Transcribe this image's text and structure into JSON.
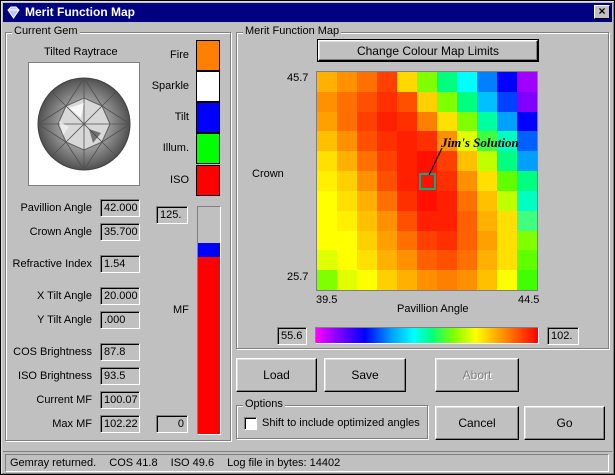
{
  "window": {
    "title": "Merit Function Map",
    "close_glyph": "×"
  },
  "current_gem": {
    "group_title": "Current Gem",
    "image_caption": "Tilted Raytrace",
    "legend": [
      {
        "label": "Fire",
        "color": "#ff8000"
      },
      {
        "label": "Sparkle",
        "color": "#ffffff"
      },
      {
        "label": "Tilt",
        "color": "#0000ff"
      },
      {
        "label": "Illum.",
        "color": "#00ff00"
      },
      {
        "label": "ISO",
        "color": "#ff0000"
      }
    ],
    "fields": [
      {
        "label": "Pavillion Angle",
        "value": "42.000"
      },
      {
        "label": "Crown Angle",
        "value": "35.700"
      },
      {
        "label": "Refractive Index",
        "value": "1.54"
      },
      {
        "label": "X Tilt Angle",
        "value": "20.000"
      },
      {
        "label": "Y Tilt Angle",
        "value": ".000"
      },
      {
        "label": "COS Brightness",
        "value": "87.8"
      },
      {
        "label": "ISO Brightness",
        "value": "93.5"
      },
      {
        "label": "Current MF",
        "value": "100.07"
      },
      {
        "label": "Max MF",
        "value": "102.22"
      }
    ],
    "mf_bar": {
      "label": "MF",
      "max_value": "125.",
      "min_value": "0",
      "blue_fraction": 0.06,
      "red_fraction": 0.78
    }
  },
  "merit_map": {
    "group_title": "Merit Function Map",
    "button_label": "Change Colour Map Limits",
    "y_label": "Crown",
    "y_max": "45.7",
    "y_min": "25.7",
    "x_label": "Pavillion Angle",
    "x_min": "39.5",
    "x_max": "44.5",
    "annotation": "Jim's Solution",
    "colorbar_min": "55.6",
    "colorbar_max": "102.",
    "grid_colors": [
      [
        "#ffb000",
        "#ff9000",
        "#ff7000",
        "#ff4000",
        "#ffd800",
        "#80ff00",
        "#00ff80",
        "#00ffff",
        "#0080ff",
        "#0000ff",
        "#a000ff"
      ],
      [
        "#ff9000",
        "#ff7000",
        "#ff5000",
        "#ff3000",
        "#ff5000",
        "#ffd000",
        "#80ff00",
        "#00ff80",
        "#00c0ff",
        "#0040ff",
        "#8000ff"
      ],
      [
        "#ffa000",
        "#ff7000",
        "#ff4000",
        "#ff2000",
        "#ff3000",
        "#ff8000",
        "#ffe000",
        "#80ff00",
        "#00ffa0",
        "#00a0ff",
        "#0000ff"
      ],
      [
        "#ffc000",
        "#ff9000",
        "#ff5000",
        "#ff3000",
        "#ff2000",
        "#ff3000",
        "#ff9000",
        "#e0ff00",
        "#40ff40",
        "#00ffc0",
        "#0060ff"
      ],
      [
        "#ffe000",
        "#ffb000",
        "#ff7000",
        "#ff4000",
        "#ff2000",
        "#ff1000",
        "#ff4000",
        "#ffc000",
        "#c0ff00",
        "#00ff80",
        "#00a0ff"
      ],
      [
        "#fff000",
        "#ffd000",
        "#ff9000",
        "#ff5000",
        "#ff2000",
        "#ff1000",
        "#ff3000",
        "#ff9000",
        "#ffe000",
        "#60ff00",
        "#00ff80"
      ],
      [
        "#ffff00",
        "#ffe000",
        "#ffb000",
        "#ff7000",
        "#ff3000",
        "#ff1000",
        "#ff2000",
        "#ff7000",
        "#ffc000",
        "#c0ff00",
        "#00ffc0"
      ],
      [
        "#ffff00",
        "#fff000",
        "#ffc000",
        "#ff9000",
        "#ff5000",
        "#ff2000",
        "#ff2000",
        "#ff6000",
        "#ffb000",
        "#ffe000",
        "#40ff80"
      ],
      [
        "#ffff00",
        "#ffff00",
        "#ffd000",
        "#ffa000",
        "#ff7000",
        "#ff4000",
        "#ff3000",
        "#ff6000",
        "#ffa000",
        "#ffe000",
        "#80ff00"
      ],
      [
        "#e0ff00",
        "#ffff00",
        "#ffe000",
        "#ffb000",
        "#ff9000",
        "#ff6000",
        "#ff5000",
        "#ff7000",
        "#ffb000",
        "#ffe000",
        "#60ff00"
      ],
      [
        "#80ff00",
        "#e0ff00",
        "#ffff00",
        "#ffd000",
        "#ffb000",
        "#ff9000",
        "#ff8000",
        "#ff9000",
        "#ffc000",
        "#ffff00",
        "#40ff00"
      ]
    ]
  },
  "actions": {
    "load": "Load",
    "save": "Save",
    "abort": "Abort",
    "cancel": "Cancel",
    "go": "Go"
  },
  "options": {
    "group_title": "Options",
    "checkbox_label": "Shift to include optimized angles",
    "checked": false
  },
  "status": {
    "message": "Gemray returned.",
    "cos": "COS  41.8",
    "iso": "ISO  49.6",
    "log": "Log file in bytes:  14402"
  }
}
